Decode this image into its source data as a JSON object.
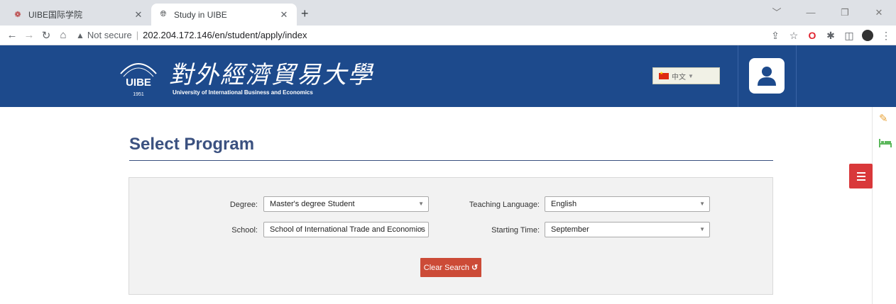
{
  "browser": {
    "tabs": [
      {
        "title": "UIBE国际学院",
        "active": false
      },
      {
        "title": "Study in UIBE",
        "active": true
      }
    ],
    "address": {
      "security_label": "Not secure",
      "url": "202.204.172.146/en/student/apply/index"
    }
  },
  "header": {
    "logo_cn": "對外經濟貿易大學",
    "logo_en": "University of International Business and Economics",
    "logo_year": "1951",
    "logo_abbr": "UIBE",
    "language_select": "中文"
  },
  "page": {
    "title": "Select Program"
  },
  "search": {
    "degree_label": "Degree:",
    "degree_value": "Master's degree Student",
    "language_label": "Teaching Language:",
    "language_value": "English",
    "school_label": "School:",
    "school_value": "School of International Trade and Economics",
    "starting_label": "Starting Time:",
    "starting_value": "September",
    "clear_button": "Clear Search"
  },
  "colors": {
    "header_bg": "#1d4a8c",
    "title": "#3b5180",
    "clear_button": "#cc4b37",
    "menu_button": "#d9383a"
  }
}
